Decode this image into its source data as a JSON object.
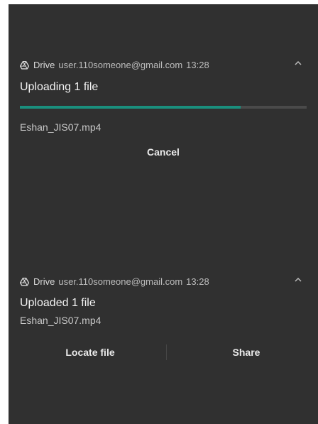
{
  "uploading_notification": {
    "app_name": "Drive",
    "account": "user.110someone@gmail.com",
    "time": "13:28",
    "title": "Uploading 1 file",
    "progress": 0.77,
    "filename": "Eshan_JIS07.mp4",
    "cancel_label": "Cancel"
  },
  "uploaded_notification": {
    "app_name": "Drive",
    "account": "user.110someone@gmail.com",
    "time": "13:28",
    "title": "Uploaded 1 file",
    "filename": "Eshan_JIS07.mp4",
    "locate_label": "Locate file",
    "share_label": "Share"
  },
  "icons": {
    "app": "google-drive-icon",
    "expand": "chevron-up-icon"
  },
  "colors": {
    "background": "#303030",
    "progress": "#1a8f7d"
  }
}
